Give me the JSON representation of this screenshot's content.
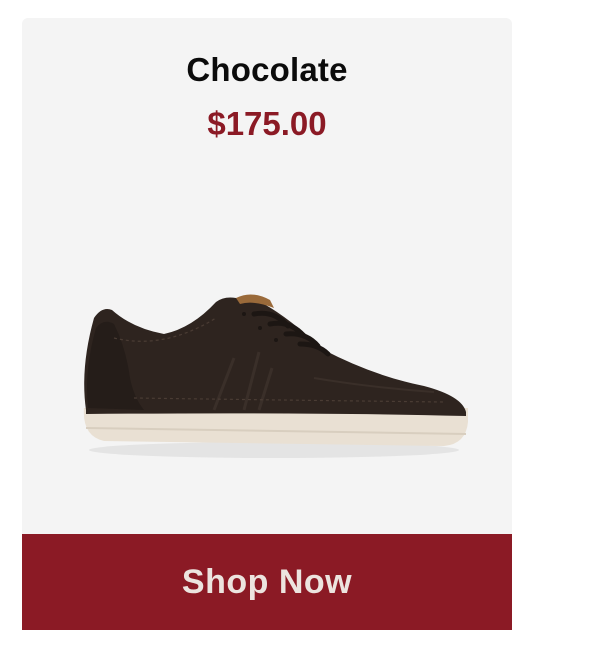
{
  "product": {
    "name": "Chocolate",
    "price": "$175.00",
    "image_icon": "sneaker-image"
  },
  "cta": {
    "label": "Shop Now"
  },
  "colors": {
    "card_background": "#f4f4f4",
    "accent": "#8b1a25",
    "shoe_upper": "#2e241f",
    "shoe_sole": "#e9e0d3"
  }
}
